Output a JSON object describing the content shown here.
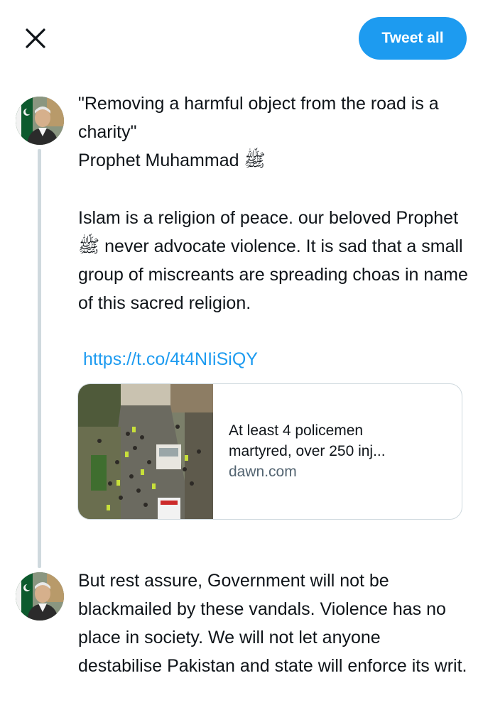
{
  "header": {
    "close_icon": "close-icon",
    "tweet_all_label": "Tweet all"
  },
  "colors": {
    "accent": "#1d9bf0",
    "text": "#0f1419",
    "secondary_text": "#536471",
    "thread_line": "#cfd9de"
  },
  "thread": {
    "tweets": [
      {
        "quote": "\"Removing a harmful object from the road is a charity\"\nProphet Muhammad ﷺ",
        "body": "Islam is a religion of peace. our beloved Prophet ﷺ never advocate violence. It is sad that a small group of miscreants are spreading choas in name of this sacred religion.",
        "link": "https://t.co/4t4NIiSiQY",
        "card": {
          "title": "At least 4 policemen martyred, over 250 inj...",
          "domain": "dawn.com"
        }
      },
      {
        "body": "But rest assure, Government will not be blackmailed by these vandals. Violence has no place in society. We will not let anyone destabilise Pakistan and state will enforce its writ."
      }
    ]
  }
}
